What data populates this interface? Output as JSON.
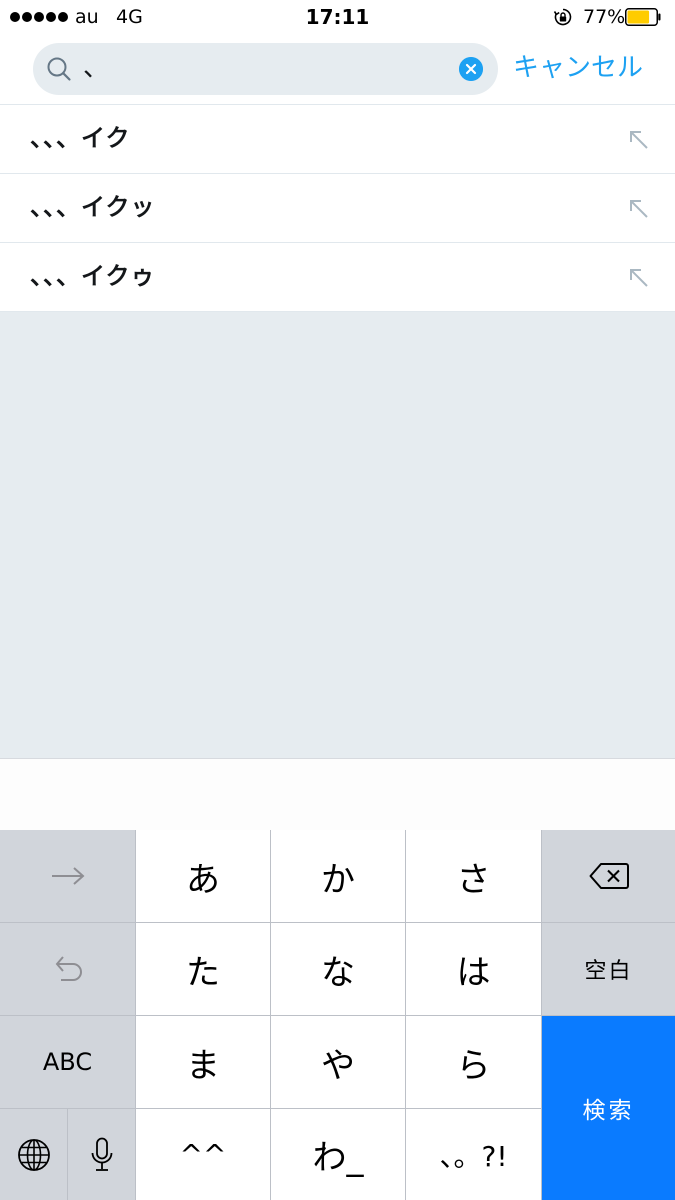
{
  "status_bar": {
    "carrier": "au",
    "network": "4G",
    "time": "17:11",
    "battery_percent": "77%",
    "battery_level": 0.77,
    "battery_color": "#ffcc00"
  },
  "search": {
    "query": "、",
    "cancel_label": "キャンセル",
    "accent_color": "#1da1f2"
  },
  "suggestions": [
    {
      "label": "、、、イク"
    },
    {
      "label": "、、、イクッ"
    },
    {
      "label": "、、、イクゥ"
    }
  ],
  "keyboard": {
    "rows": [
      [
        "あ",
        "か",
        "さ"
      ],
      [
        "た",
        "な",
        "は"
      ],
      [
        "ま",
        "や",
        "ら"
      ],
      [
        "^^",
        "わ_",
        "、。?!"
      ]
    ],
    "space_label": "空白",
    "abc_label": "ABC",
    "search_label": "検索",
    "icons": [
      "arrow-right-icon",
      "undo-icon",
      "globe-icon",
      "microphone-icon",
      "backspace-icon"
    ],
    "action_color": "#0a7bff"
  }
}
